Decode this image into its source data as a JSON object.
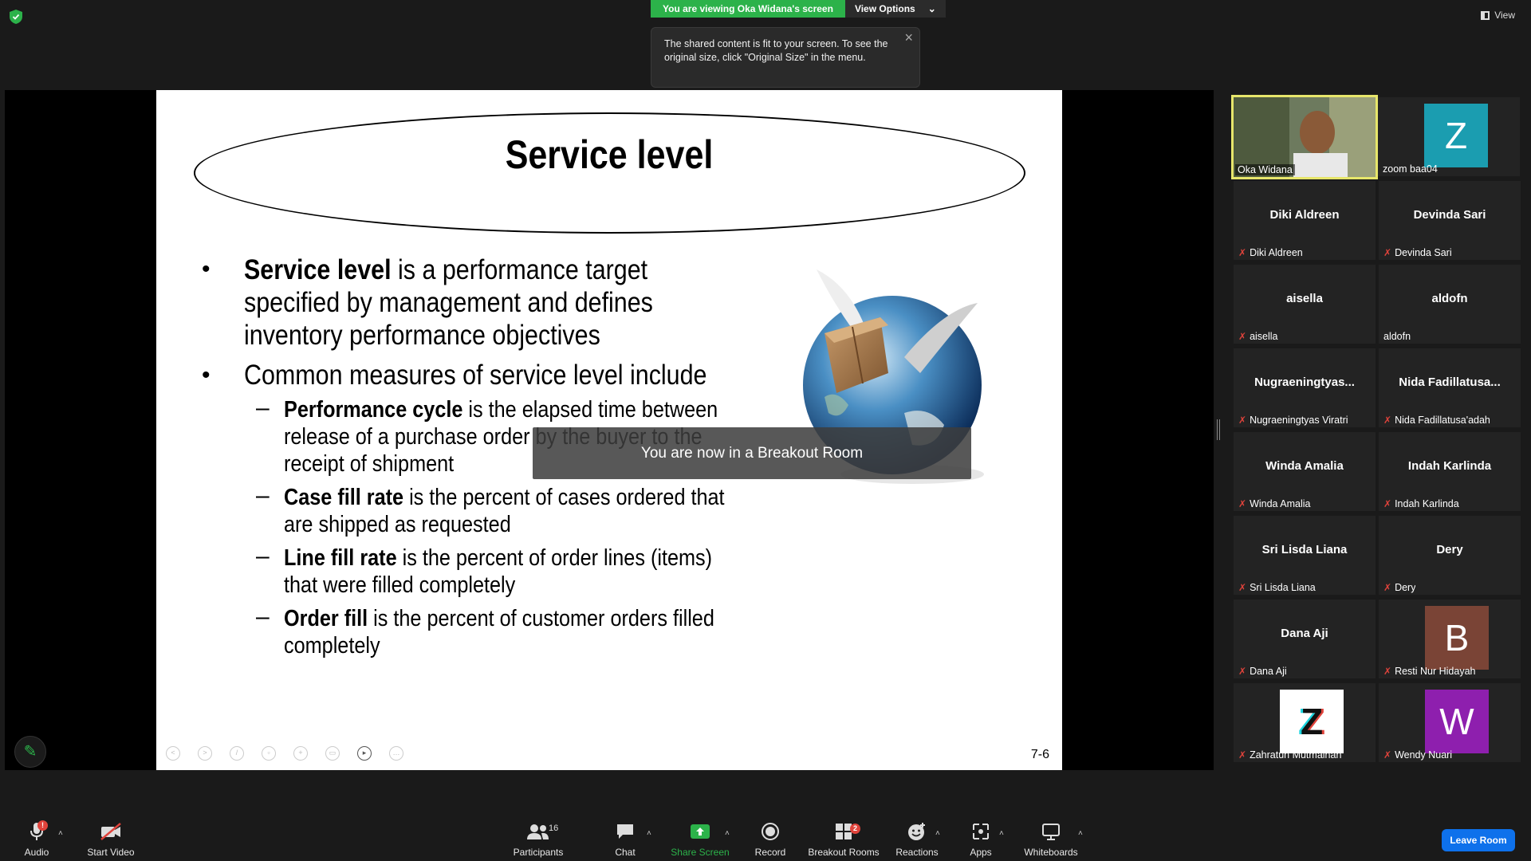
{
  "top": {
    "viewing_banner": "You are viewing Oka Widana's screen",
    "view_options": "View Options",
    "tooltip": "The shared content is fit to your screen. To see the original size, click \"Original Size\" in the menu.",
    "view_label": "View"
  },
  "slide": {
    "title": "Service level",
    "bullet1_bold": "Service level",
    "bullet1_rest": " is a performance target",
    "bullet1_line2": "specified by management and defines",
    "bullet1_line3": "inventory performance objectives",
    "bullet2": "Common measures of service level include",
    "sub1_bold": "Performance cycle",
    "sub1_rest": " is the elapsed time between",
    "sub1_line2": "release of a purchase order by the buyer to the",
    "sub1_line3": "receipt of shipment",
    "sub2_bold": "Case fill rate",
    "sub2_rest": " is the percent of cases ordered that",
    "sub2_line2": "are shipped as requested",
    "sub3_bold": "Line fill rate",
    "sub3_rest": " is the percent of order lines (items)",
    "sub3_line2": "that were filled completely",
    "sub4_bold": "Order fill",
    "sub4_rest": " is the percent of customer orders filled",
    "sub4_line2": "completely",
    "number": "7-6"
  },
  "breakout_toast": "You are now in a Breakout Room",
  "participants": [
    {
      "display": "",
      "label": "Oka Widana",
      "muted": false,
      "video": true
    },
    {
      "display": "Z",
      "label": "zoom baa04",
      "muted": false,
      "avatar_color": "#1b9db0"
    },
    {
      "display": "Diki Aldreen",
      "label": "Diki Aldreen",
      "muted": true
    },
    {
      "display": "Devinda Sari",
      "label": "Devinda Sari",
      "muted": true
    },
    {
      "display": "aisella",
      "label": "aisella",
      "muted": true
    },
    {
      "display": "aldofn",
      "label": "aldofn",
      "muted": false
    },
    {
      "display": "Nugraeningtyas...",
      "label": "Nugraeningtyas Viratri",
      "muted": true
    },
    {
      "display": "Nida  Fadillatusa...",
      "label": "Nida Fadillatusa'adah",
      "muted": true
    },
    {
      "display": "Winda Amalia",
      "label": "Winda Amalia",
      "muted": true
    },
    {
      "display": "Indah Karlinda",
      "label": "Indah Karlinda",
      "muted": true
    },
    {
      "display": "Sri Lisda Liana",
      "label": "Sri Lisda Liana",
      "muted": true
    },
    {
      "display": "Dery",
      "label": "Dery",
      "muted": true
    },
    {
      "display": "Dana Aji",
      "label": "Dana Aji",
      "muted": true
    },
    {
      "display": "B",
      "label": "Resti Nur Hidayah",
      "muted": true,
      "avatar_color": "#7a4436"
    },
    {
      "display": "Z",
      "label": "Zahratun Mutmainah",
      "muted": true,
      "avatar_color": "#ffffff"
    },
    {
      "display": "W",
      "label": "Wendy Nuari",
      "muted": true,
      "avatar_color": "#8e1fae"
    }
  ],
  "toolbar": {
    "audio": "Audio",
    "audio_badge": "!",
    "start_video": "Start Video",
    "participants": "Participants",
    "participants_count": "16",
    "chat": "Chat",
    "share_screen": "Share Screen",
    "record": "Record",
    "breakout_rooms": "Breakout Rooms",
    "breakout_badge": "2",
    "reactions": "Reactions",
    "apps": "Apps",
    "whiteboards": "Whiteboards",
    "leave": "Leave Room"
  },
  "colors": {
    "share_green": "#2cb24a",
    "leave_blue": "#0e71eb",
    "muted_red": "#e0433b",
    "active_speaker": "#e7e66b"
  }
}
